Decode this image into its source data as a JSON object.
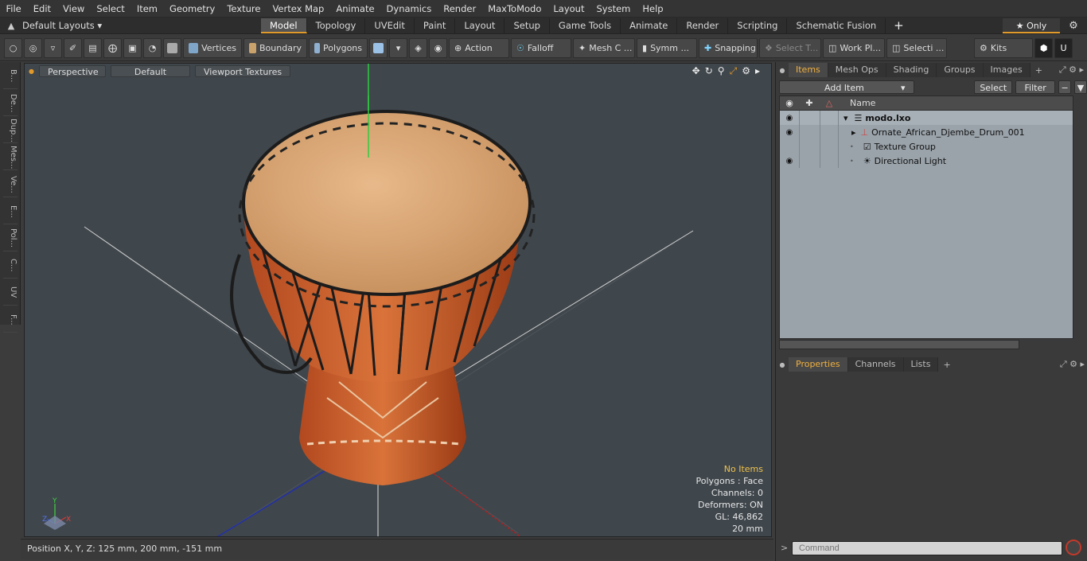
{
  "menu": [
    "File",
    "Edit",
    "View",
    "Select",
    "Item",
    "Geometry",
    "Texture",
    "Vertex Map",
    "Animate",
    "Dynamics",
    "Render",
    "MaxToModo",
    "Layout",
    "System",
    "Help"
  ],
  "layouts": {
    "current": "Default Layouts ▾",
    "tabs": [
      "Model",
      "Topology",
      "UVEdit",
      "Paint",
      "Layout",
      "Setup",
      "Game Tools",
      "Animate",
      "Render",
      "Scripting",
      "Schematic Fusion"
    ],
    "active": "Model",
    "add": "+",
    "only": "★ Only"
  },
  "toolbar": {
    "vertices": "Vertices",
    "boundary": "Boundary",
    "polygons": "Polygons",
    "action": "Action",
    "falloff": "Falloff",
    "mesh": "Mesh C ...",
    "symm": "Symm ...",
    "snapping": "Snapping",
    "select_t": "Select T...",
    "work_plane": "Work Pl...",
    "selection": "Selecti ...",
    "kits": "Kits"
  },
  "lefttabs": [
    "B...",
    "De...",
    "Dup...",
    "Mes...",
    "Ve...",
    "E...",
    "Pol...",
    "C...",
    "UV",
    "F..."
  ],
  "viewport": {
    "view": "Perspective",
    "shading": "Default",
    "textures": "Viewport Textures",
    "info": {
      "warn": "No Items",
      "polygons": "Polygons : Face",
      "channels": "Channels: 0",
      "deformers": "Deformers: ON",
      "gl": "GL: 46,862",
      "unit": "20 mm"
    },
    "axis": {
      "x": "X",
      "y": "Y",
      "z": "Z"
    }
  },
  "status": "Position X, Y, Z:   125 mm, 200 mm, -151 mm",
  "items_panel": {
    "tabs": [
      "Items",
      "Mesh Ops",
      "Shading",
      "Groups",
      "Images",
      "+"
    ],
    "active": "Items",
    "add_item": "Add Item",
    "select": "Select",
    "filter": "Filter",
    "col_name": "Name",
    "rows": [
      {
        "name": "modo.lxo",
        "indent": 0
      },
      {
        "name": "Ornate_African_Djembe_Drum_001",
        "indent": 1
      },
      {
        "name": "Texture Group",
        "indent": 1
      },
      {
        "name": "Directional Light",
        "indent": 1
      }
    ]
  },
  "props_panel": {
    "tabs": [
      "Properties",
      "Channels",
      "Lists",
      "+"
    ],
    "active": "Properties"
  },
  "command": {
    "placeholder": "Command"
  },
  "colors": {
    "accent": "#e09a2c",
    "viewport_bg": "#3f464c",
    "list_bg": "#9aa3aa"
  }
}
